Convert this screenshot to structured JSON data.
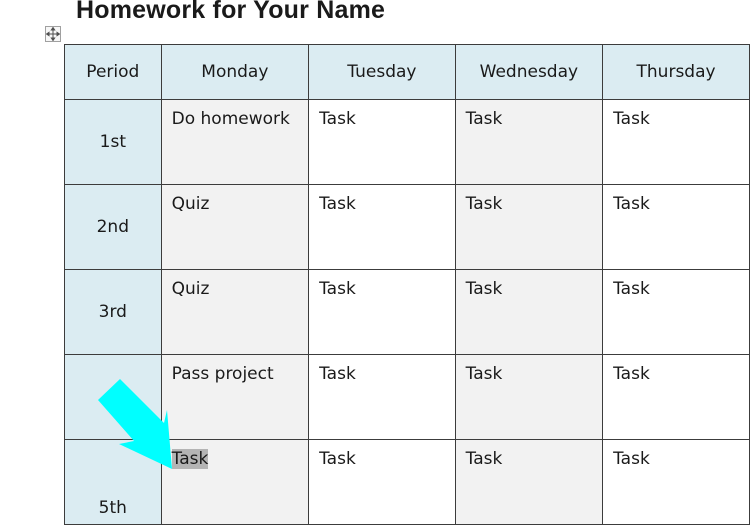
{
  "document": {
    "title": "Homework for Your Name"
  },
  "table": {
    "headers": [
      "Period",
      "Monday",
      "Tuesday",
      "Wednesday",
      "Thursday"
    ],
    "rows": [
      {
        "period": "1st",
        "cells": [
          "Do homework",
          "Task",
          "Task",
          "Task"
        ]
      },
      {
        "period": "2nd",
        "cells": [
          "Quiz",
          "Task",
          "Task",
          "Task"
        ]
      },
      {
        "period": "3rd",
        "cells": [
          "Quiz",
          "Task",
          "Task",
          "Task"
        ]
      },
      {
        "period": "",
        "cells": [
          "Pass project",
          "Task",
          "Task",
          "Task"
        ]
      },
      {
        "period": "5th",
        "cells": [
          "Task",
          "Task",
          "Task",
          "Task"
        ],
        "selected_cell": 0
      }
    ]
  },
  "annotation": {
    "arrow_color": "#00ffff",
    "target": "Task (5th period, Monday)"
  },
  "icons": {
    "table_move_handle": "move-arrows-icon"
  }
}
